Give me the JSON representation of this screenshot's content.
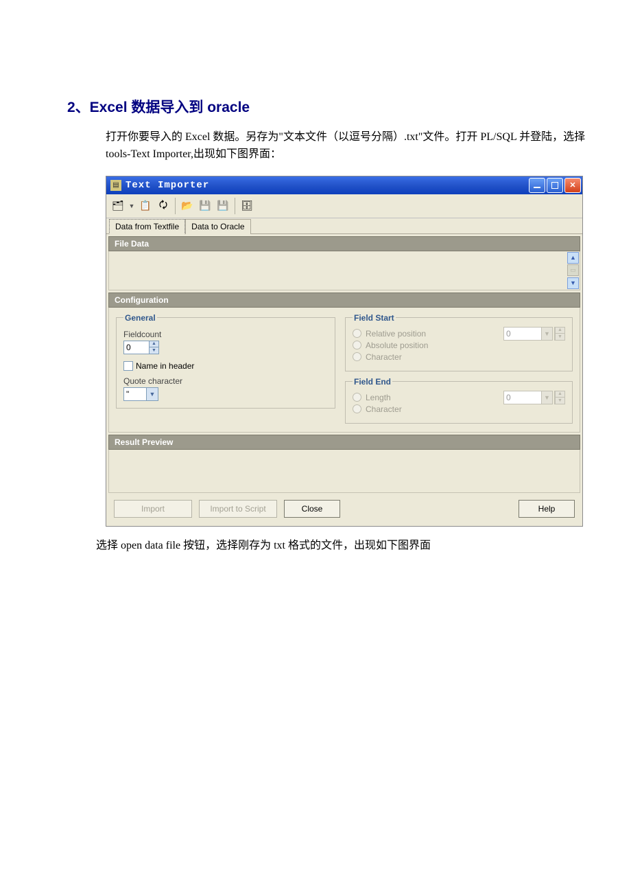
{
  "heading": "2、Excel 数据导入到 oracle",
  "intro": "打开你要导入的 Excel 数据。另存为\"文本文件（以逗号分隔）.txt\"文件。打开 PL/SQL 并登陆，选择 tools-Text Importer,出现如下图界面：",
  "outro": "选择 open data file  按钮，选择刚存为 txt 格式的文件，出现如下图界面",
  "window": {
    "title": "Text Importer",
    "tabs": {
      "t1": "Data from Textfile",
      "t2": "Data to Oracle"
    },
    "sections": {
      "filedata": "File Data",
      "config": "Configuration",
      "result": "Result Preview"
    },
    "general": {
      "legend": "General",
      "fieldcount_label": "Fieldcount",
      "fieldcount_value": "0",
      "name_in_header": "Name in header",
      "quote_label": "Quote character",
      "quote_value": "\""
    },
    "fieldstart": {
      "legend": "Field Start",
      "relative": "Relative position",
      "absolute": "Absolute position",
      "character": "Character",
      "value": "0"
    },
    "fieldend": {
      "legend": "Field End",
      "length": "Length",
      "character": "Character",
      "value": "0"
    },
    "buttons": {
      "import": "Import",
      "import_script": "Import to Script",
      "close": "Close",
      "help": "Help"
    }
  }
}
